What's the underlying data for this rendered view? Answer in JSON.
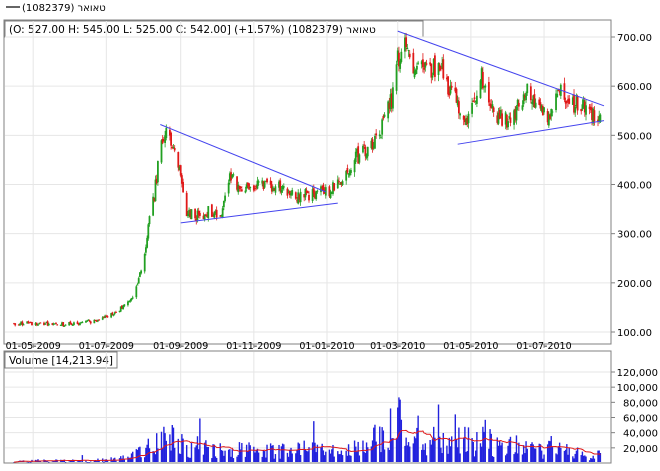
{
  "window_title": "טאואר (1082379)",
  "price_panel": {
    "info_text": "(O: 527.00  H: 545.00  L: 525.00  C: 542.00] (+1.57%) (1082379) טאואר",
    "y_ticks": [
      "100.00",
      "200.00",
      "300.00",
      "400.00",
      "500.00",
      "600.00",
      "700.00"
    ],
    "x_ticks": [
      "01-05-2009",
      "01-07-2009",
      "01-09-2009",
      "01-11-2009",
      "01-01-2010",
      "01-03-2010",
      "01-05-2010",
      "01-07-2010"
    ]
  },
  "volume_panel": {
    "label": "Volume [14,213.94]",
    "y_ticks": [
      "20,000",
      "40,000",
      "60,000",
      "80,000",
      "100,000",
      "120,000"
    ]
  },
  "colors": {
    "up_candle": "#22a022",
    "down_candle": "#e01818",
    "volume_bar": "#2222dd",
    "volume_ma": "#e01818",
    "trendline": "#4444ee",
    "frame": "#808080"
  },
  "chart_data": [
    {
      "type": "candlestick",
      "x_range": [
        "2009-04-15",
        "2010-08-20"
      ],
      "ylim": [
        100,
        720
      ],
      "close_anchors": [
        [
          "2009-04-15",
          117
        ],
        [
          "2009-05-01",
          118
        ],
        [
          "2009-05-25",
          116
        ],
        [
          "2009-06-10",
          118
        ],
        [
          "2009-06-25",
          125
        ],
        [
          "2009-07-05",
          135
        ],
        [
          "2009-07-15",
          150
        ],
        [
          "2009-07-25",
          180
        ],
        [
          "2009-08-01",
          250
        ],
        [
          "2009-08-06",
          330
        ],
        [
          "2009-08-10",
          380
        ],
        [
          "2009-08-15",
          470
        ],
        [
          "2009-08-20",
          505
        ],
        [
          "2009-08-27",
          470
        ],
        [
          "2009-09-01",
          410
        ],
        [
          "2009-09-05",
          350
        ],
        [
          "2009-09-12",
          335
        ],
        [
          "2009-09-25",
          345
        ],
        [
          "2009-10-05",
          345
        ],
        [
          "2009-10-10",
          420
        ],
        [
          "2009-10-20",
          395
        ],
        [
          "2009-11-05",
          400
        ],
        [
          "2009-11-20",
          395
        ],
        [
          "2009-12-10",
          375
        ],
        [
          "2009-12-25",
          385
        ],
        [
          "2010-01-05",
          390
        ],
        [
          "2010-01-15",
          420
        ],
        [
          "2010-01-25",
          455
        ],
        [
          "2010-02-05",
          470
        ],
        [
          "2010-02-15",
          510
        ],
        [
          "2010-02-25",
          580
        ],
        [
          "2010-03-01",
          650
        ],
        [
          "2010-03-05",
          690
        ],
        [
          "2010-03-12",
          640
        ],
        [
          "2010-03-25",
          630
        ],
        [
          "2010-04-05",
          640
        ],
        [
          "2010-04-12",
          590
        ],
        [
          "2010-04-22",
          560
        ],
        [
          "2010-04-28",
          520
        ],
        [
          "2010-05-05",
          580
        ],
        [
          "2010-05-10",
          620
        ],
        [
          "2010-05-20",
          540
        ],
        [
          "2010-06-01",
          530
        ],
        [
          "2010-06-10",
          560
        ],
        [
          "2010-06-18",
          595
        ],
        [
          "2010-06-25",
          550
        ],
        [
          "2010-07-05",
          540
        ],
        [
          "2010-07-12",
          590
        ],
        [
          "2010-07-25",
          565
        ],
        [
          "2010-08-05",
          555
        ],
        [
          "2010-08-12",
          542
        ]
      ],
      "last_bar": {
        "open": 527.0,
        "high": 545.0,
        "low": 525.0,
        "close": 542.0,
        "change_pct": 1.57
      },
      "trendlines": [
        {
          "from": [
            "2009-08-15",
            522
          ],
          "to": [
            "2009-12-31",
            385
          ]
        },
        {
          "from": [
            "2009-09-01",
            322
          ],
          "to": [
            "2010-01-10",
            362
          ]
        },
        {
          "from": [
            "2010-03-01",
            712
          ],
          "to": [
            "2010-08-20",
            560
          ]
        },
        {
          "from": [
            "2010-04-20",
            482
          ],
          "to": [
            "2010-08-20",
            530
          ]
        }
      ]
    },
    {
      "type": "bar",
      "ylim": [
        0,
        130000
      ],
      "moving_average": true,
      "volume_anchors": [
        [
          "2009-04-15",
          3000
        ],
        [
          "2009-06-25",
          4000
        ],
        [
          "2009-07-15",
          8000
        ],
        [
          "2009-07-25",
          15000
        ],
        [
          "2009-08-05",
          30000
        ],
        [
          "2009-08-20",
          45000
        ],
        [
          "2009-09-05",
          28000
        ],
        [
          "2009-10-10",
          20000
        ],
        [
          "2009-11-20",
          18000
        ],
        [
          "2009-12-25",
          22000
        ],
        [
          "2010-01-25",
          24000
        ],
        [
          "2010-02-15",
          40000
        ],
        [
          "2010-03-01",
          70000
        ],
        [
          "2010-03-10",
          55000
        ],
        [
          "2010-04-05",
          30000
        ],
        [
          "2010-05-10",
          35000
        ],
        [
          "2010-06-10",
          25000
        ],
        [
          "2010-07-12",
          20000
        ],
        [
          "2010-08-12",
          12000
        ]
      ]
    }
  ]
}
